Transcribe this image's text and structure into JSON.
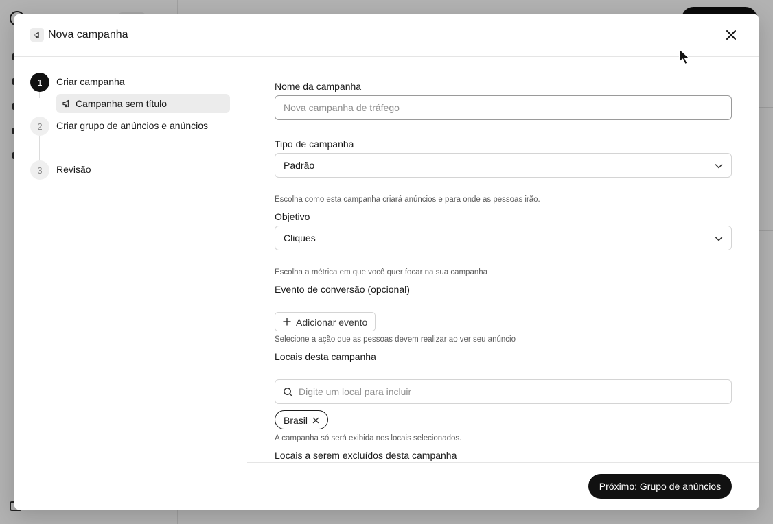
{
  "modal": {
    "title": "Nova campanha",
    "icon": "megaphone-icon",
    "close_icon": "close-icon"
  },
  "steps": [
    {
      "number": "1",
      "label": "Criar campanha",
      "state": "active"
    },
    {
      "number": "2",
      "label": "Criar grupo de anúncios e anúncios",
      "state": "inactive"
    },
    {
      "number": "3",
      "label": "Revisão",
      "state": "inactive"
    }
  ],
  "substep": {
    "label": "Campanha sem título",
    "icon": "megaphone-icon"
  },
  "form": {
    "campaign_name": {
      "label": "Nome da campanha",
      "value": "",
      "placeholder": "Nova campanha de tráfego"
    },
    "campaign_type": {
      "label": "Tipo de campanha",
      "value": "Padrão",
      "helper": "Escolha como esta campanha criará anúncios e para onde as pessoas irão."
    },
    "objective": {
      "label": "Objetivo",
      "value": "Cliques",
      "helper": "Escolha a métrica em que você quer focar na sua campanha"
    },
    "conversion_event": {
      "label": "Evento de conversão (opcional)",
      "button_label": "Adicionar evento",
      "helper": "Selecione a ação que as pessoas devem realizar ao ver seu anúncio"
    },
    "locations": {
      "label": "Locais desta campanha",
      "placeholder": "Digite um local para incluir",
      "chips": [
        "Brasil"
      ],
      "helper": "A campanha só será exibida nos locais selecionados."
    },
    "excluded_locations": {
      "label": "Locais a serem excluídos desta campanha"
    }
  },
  "footer": {
    "next_label": "Próximo: Grupo de anúncios"
  },
  "colors": {
    "primary": "#111111",
    "border": "#d4d4d4",
    "muted_text": "#5c5c5c",
    "overlay": "rgba(0,0,0,0.30)"
  }
}
